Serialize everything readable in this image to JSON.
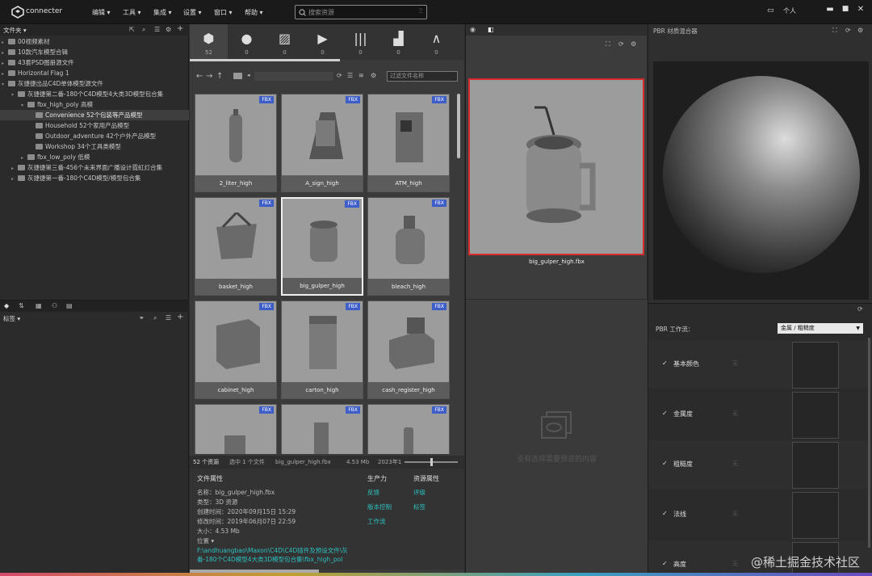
{
  "app": {
    "name": "connecter"
  },
  "menu": [
    {
      "label": "编辑"
    },
    {
      "label": "工具"
    },
    {
      "label": "集成"
    },
    {
      "label": "设置"
    },
    {
      "label": "窗口"
    },
    {
      "label": "帮助"
    }
  ],
  "search": {
    "placeholder": "搜索资源"
  },
  "user": {
    "label": "个人"
  },
  "tree": {
    "header": "文件夹",
    "items": [
      {
        "label": "00视频素材",
        "selected": false
      },
      {
        "label": "10款汽车模型合辑",
        "selected": false
      },
      {
        "label": "43套PSD图册源文件",
        "selected": false
      },
      {
        "label": "Horizontal Flag 1",
        "selected": false
      },
      {
        "label": "灰捷捷出品C4D单体模型源文件",
        "selected": false
      },
      {
        "label": "灰捷捷第二番-180个C4D模型4大类3D模型包合集",
        "selected": false
      },
      {
        "label": "fbx_high_poly 高模",
        "selected": false
      },
      {
        "label": "Convenience 52个包装等产品模型",
        "selected": true
      },
      {
        "label": "Household 52个家用产品模型",
        "selected": false
      },
      {
        "label": "Outdoor_adventure 42个户外产品模型",
        "selected": false
      },
      {
        "label": "Workshop 34个工具类模型",
        "selected": false
      },
      {
        "label": "fbx_low_poly 低模",
        "selected": false
      },
      {
        "label": "灰捷捷第三番-456个未来界面广播设计霓虹灯合集",
        "selected": false
      },
      {
        "label": "灰捷捷第一番-180个C4D模型/模型包合集",
        "selected": false
      }
    ]
  },
  "tags": {
    "header": "标签"
  },
  "types": [
    {
      "icon": "cube-icon",
      "count": "52"
    },
    {
      "icon": "sphere-icon",
      "count": "0"
    },
    {
      "icon": "image-icon",
      "count": "0"
    },
    {
      "icon": "video-icon",
      "count": "0"
    },
    {
      "icon": "audio-icon",
      "count": "0"
    },
    {
      "icon": "building-icon",
      "count": "0"
    },
    {
      "icon": "compass-icon",
      "count": "0"
    }
  ],
  "filter": {
    "placeholder": "过滤文件名称"
  },
  "assets": [
    {
      "name": "2_liter_high",
      "badge": "FBX"
    },
    {
      "name": "A_sign_high",
      "badge": "FBX"
    },
    {
      "name": "ATM_high",
      "badge": "FBX"
    },
    {
      "name": "basket_high",
      "badge": "FBX"
    },
    {
      "name": "big_gulper_high",
      "badge": "FBX"
    },
    {
      "name": "bleach_high",
      "badge": "FBX"
    },
    {
      "name": "cabinet_high",
      "badge": "FBX"
    },
    {
      "name": "carton_high",
      "badge": "FBX"
    },
    {
      "name": "cash_register_high",
      "badge": "FBX"
    },
    {
      "name": "",
      "badge": "FBX"
    },
    {
      "name": "",
      "badge": "FBX"
    },
    {
      "name": "",
      "badge": "FBX"
    }
  ],
  "status": {
    "total": "52 个资源",
    "selected": "选中 1 个文件",
    "file": "big_gulper_high.fbx",
    "size": "4.53 Mb",
    "date": "2023年1"
  },
  "props": {
    "header_file": "文件属性",
    "header_prod": "生产力",
    "header_asset": "资源属性",
    "name": "名称：big_gulper_high.fbx",
    "type": "类型：3D 资源",
    "created": "创建时间：2020年09月15日 15:29",
    "modified": "修改时间：2019年06月07日 22:59",
    "size": "大小：4.53 Mb",
    "location_label": "位置",
    "path1": "F:\\andhuangbao\\Maxon\\C4D\\C4D插件及预设文件\\灰",
    "path2": "番-180个C4D模型4大类3D模型包合集\\fbx_high_pol",
    "prod_links": [
      "反馈",
      "版本控制",
      "工作流"
    ],
    "asset_links": [
      "评级",
      "标签"
    ]
  },
  "preview": {
    "filename": "big_gulper_high.fbx",
    "empty_text": "没有选择需要预览的内容"
  },
  "pbr": {
    "title": "PBR 材质混合器",
    "workflow_label": "PBR 工作流：",
    "workflow_value": "金属 / 粗糙度",
    "channels": [
      {
        "name": "基本颜色",
        "hint": "无"
      },
      {
        "name": "金属度",
        "hint": "无"
      },
      {
        "name": "粗糙度",
        "hint": "无"
      },
      {
        "name": "法线",
        "hint": "无"
      },
      {
        "name": "高度",
        "hint": "无"
      }
    ]
  },
  "watermark": "@稀土掘金技术社区",
  "colors": {
    "accent": "#3d5ec9",
    "selection": "#d62c2c",
    "link": "#2ec0c0"
  }
}
